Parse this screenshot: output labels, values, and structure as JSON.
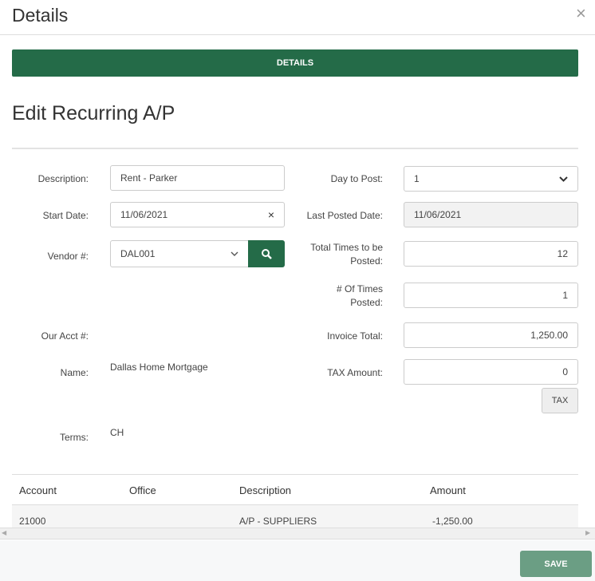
{
  "modal": {
    "title": "Details",
    "close": "×"
  },
  "banner": "DETAILS",
  "heading": "Edit Recurring A/P",
  "left": {
    "description_label": "Description:",
    "description": "Rent - Parker",
    "start_date_label": "Start Date:",
    "start_date": "11/06/2021",
    "clear": "×",
    "vendor_label": "Vendor #:",
    "vendor": "DAL001",
    "acct_label": "Our Acct #:",
    "name_label": "Name:",
    "name": "Dallas Home Mortgage",
    "terms_label": "Terms:",
    "terms": "CH"
  },
  "right": {
    "day_label": "Day to Post:",
    "day": "1",
    "last_label": "Last Posted Date:",
    "last": "11/06/2021",
    "total_label_1": "Total Times to be",
    "total_label_2": "Posted:",
    "total": "12",
    "times_label_1": "# Of Times",
    "times_label_2": "Posted:",
    "times": "1",
    "invoice_label": "Invoice Total:",
    "invoice": "1,250.00",
    "tax_label": "TAX Amount:",
    "tax": "0",
    "tax_button": "TAX"
  },
  "table": {
    "headers": [
      "Account",
      "Office",
      "Description",
      "Amount"
    ],
    "rows": [
      {
        "account": "21000",
        "office": "",
        "description": "A/P - SUPPLIERS",
        "amount": "-1,250.00"
      }
    ]
  },
  "footer": {
    "save": "SAVE"
  },
  "colors": {
    "primary": "#246b48"
  }
}
